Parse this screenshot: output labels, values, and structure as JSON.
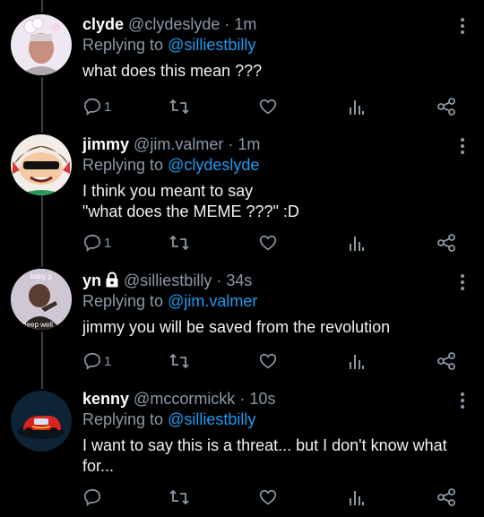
{
  "tweets": [
    {
      "name": "clyde",
      "handle": "@clydeslyde",
      "dot": "·",
      "time": "1m",
      "replying_prefix": "Replying to",
      "replying_to": "@silliestbilly",
      "lines": [
        "what does this mean ???"
      ],
      "reply_count": "1",
      "locked": false
    },
    {
      "name": "jimmy",
      "handle": "@jim.valmer",
      "dot": "·",
      "time": "1m",
      "replying_prefix": "Replying to",
      "replying_to": "@clydeslyde",
      "lines": [
        "I think you meant to say",
        "\"what does the MEME ???\" :D"
      ],
      "reply_count": "1",
      "locked": false
    },
    {
      "name": "yn",
      "handle": "@silliestbilly",
      "dot": "·",
      "time": "34s",
      "replying_prefix": "Replying to",
      "replying_to": "@jim.valmer",
      "lines": [
        "jimmy you will be saved from the revolution"
      ],
      "reply_count": "1",
      "locked": true,
      "avatar_text_top": "baby g",
      "avatar_text_bottom": "deep well"
    },
    {
      "name": "kenny",
      "handle": "@mccormickk",
      "dot": "·",
      "time": "10s",
      "replying_prefix": "Replying to",
      "replying_to": "@silliestbilly",
      "lines": [
        "I want to say this is a threat... but I don't know what",
        "for..."
      ],
      "reply_count": "",
      "locked": false
    }
  ],
  "icons": {
    "reply": "reply-icon",
    "retweet": "retweet-icon",
    "like": "heart-icon",
    "views": "analytics-icon",
    "share": "share-icon",
    "more": "more-options-icon",
    "lock": "lock-icon"
  },
  "colors": {
    "background": "#000000",
    "text": "#e7e9ea",
    "secondary": "#8b98a5",
    "mention": "#1d9bf0",
    "thread_line": "#3b3f44"
  }
}
